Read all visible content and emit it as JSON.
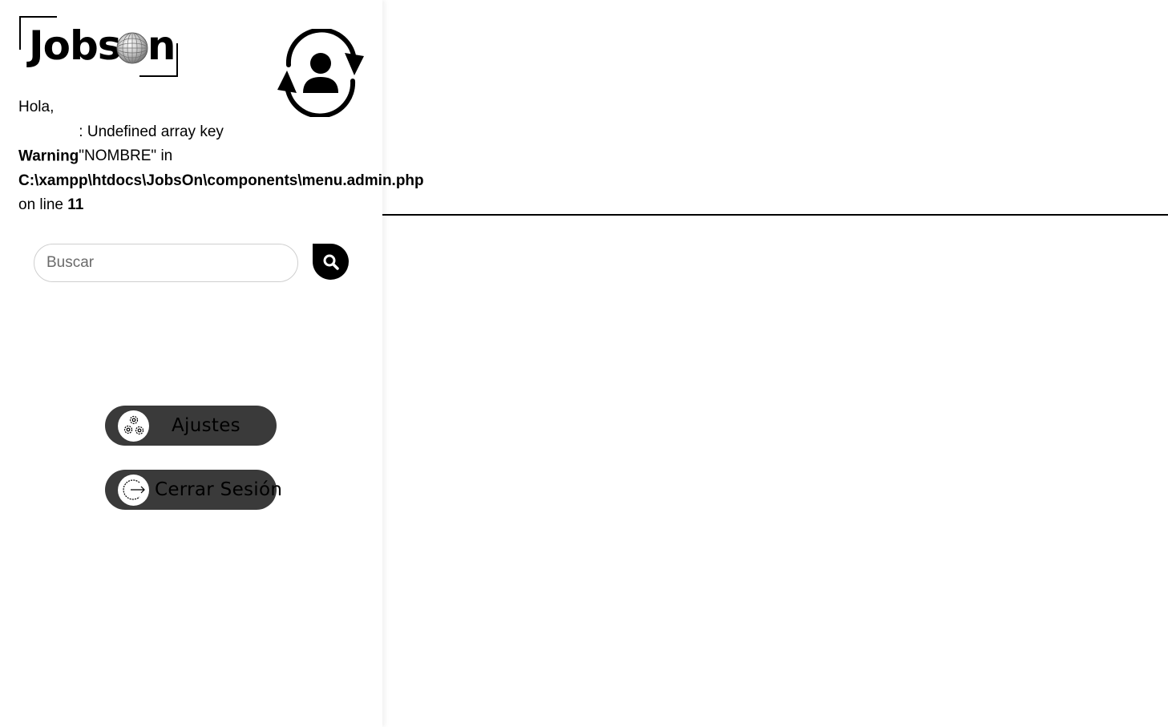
{
  "brand": {
    "logo_text": "Jobson"
  },
  "greeting": {
    "hello": "Hola,",
    "warning_label": "Warning",
    "warning_message": ": Undefined array key \"NOMBRE\" in",
    "warning_path": "C:\\xampp\\htdocs\\JobsOn\\components\\menu.admin.php",
    "warning_line_prefix": "on line",
    "warning_line_number": "11"
  },
  "search": {
    "placeholder": "Buscar",
    "button_icon": "search-icon"
  },
  "menu": [
    {
      "label": "Ajustes",
      "icon": "gears-icon"
    },
    {
      "label": "Cerrar Sesión",
      "icon": "logout-icon"
    }
  ],
  "icons": {
    "switch_user": "user-switch-icon"
  },
  "colors": {
    "pill_background": "#3a3a3a",
    "accent": "#000000"
  }
}
